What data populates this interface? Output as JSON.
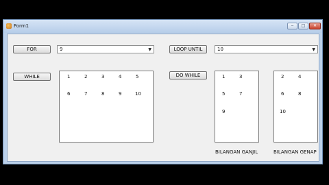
{
  "window": {
    "title": "Form1",
    "controls": {
      "minimize": "‒",
      "maximize": "□",
      "close": "✕"
    }
  },
  "buttons": {
    "for": "FOR",
    "while": "WHILE",
    "loop_until": "LOOP UNTIL",
    "do_while": "DO WHILE"
  },
  "combos": {
    "for_value": "9",
    "loop_until_value": "10",
    "arrow": "▼"
  },
  "lists": {
    "while_items": [
      "1",
      "2",
      "3",
      "4",
      "5",
      "6",
      "7",
      "8",
      "9",
      "10"
    ],
    "ganjil_items": [
      "1",
      "3",
      "5",
      "7",
      "9"
    ],
    "genap_items": [
      "2",
      "4",
      "6",
      "8",
      "10"
    ]
  },
  "labels": {
    "ganjil": "BILANGAN GANJIL",
    "genap": "BILANGAN GENAP"
  }
}
